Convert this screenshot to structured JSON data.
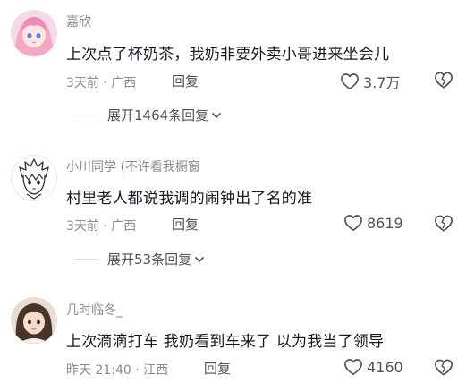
{
  "comments": [
    {
      "author": "嘉欣",
      "text": "上次点了杯奶茶，我奶非要外卖小哥进来坐会儿",
      "meta": "3天前 · 广西",
      "reply_label": "回复",
      "likes": "3.7万",
      "expand_label": "展开1464条回复"
    },
    {
      "author": "小川同学 (不许看我橱窗",
      "text": "村里老人都说我调的闹钟出了名的准",
      "meta": "3天前 · 广西",
      "reply_label": "回复",
      "likes": "8619",
      "expand_label": "展开53条回复"
    },
    {
      "author": "几时临冬_",
      "text": "上次滴滴打车 我奶看到车来了 以为我当了领导",
      "meta": "昨天 21:40 · 江西",
      "reply_label": "回复",
      "likes": "4160"
    }
  ],
  "icons": {
    "like": "heart-outline-icon",
    "dislike": "broken-heart-icon",
    "expand": "chevron-down-icon"
  },
  "colors": {
    "primary_text": "#161823",
    "secondary_text": "#8a8b91",
    "action_text": "#505259"
  }
}
